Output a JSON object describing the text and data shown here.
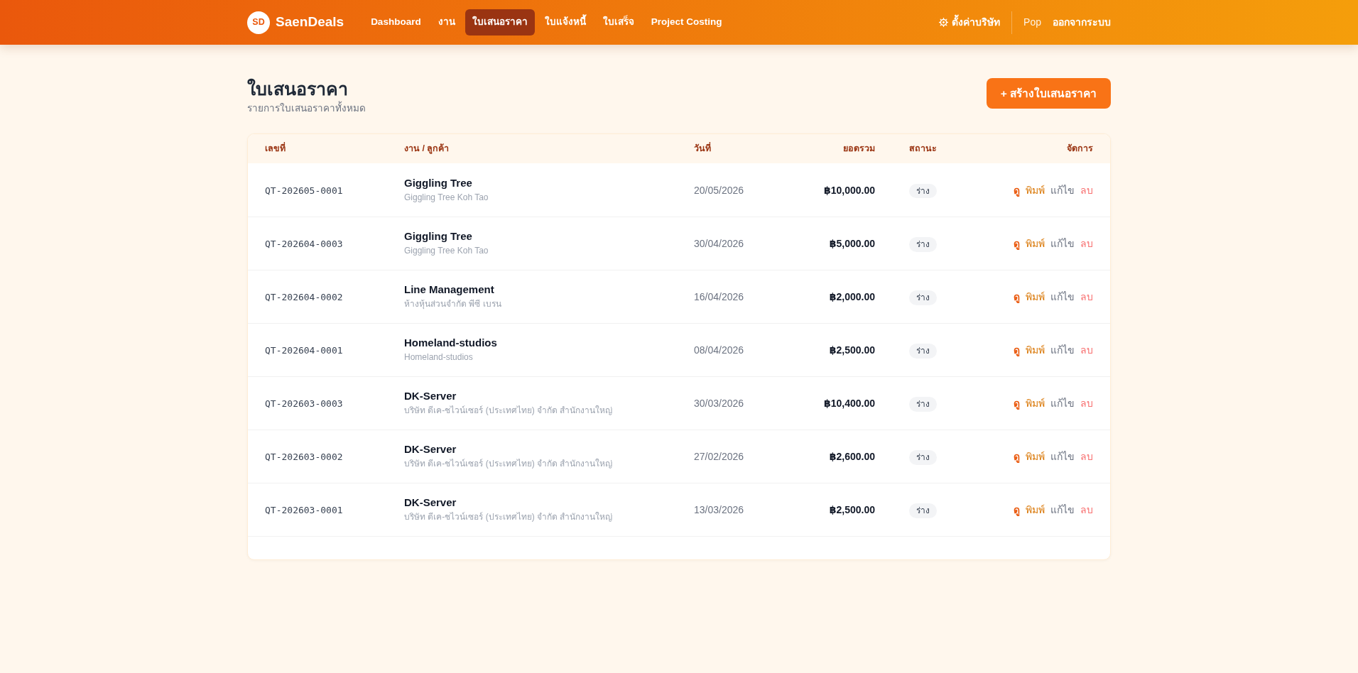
{
  "navbar": {
    "logo": "SD",
    "brand": "SaenDeals",
    "items": [
      {
        "label": "Dashboard",
        "selected": false
      },
      {
        "label": "งาน",
        "selected": false
      },
      {
        "label": "ใบเสนอราคา",
        "selected": true
      },
      {
        "label": "ใบแจ้งหนี้",
        "selected": false
      },
      {
        "label": "ใบเสร็จ",
        "selected": false
      },
      {
        "label": "Project Costing",
        "selected": false
      }
    ],
    "settings": "ตั้งค่าบริษัท",
    "user": "Pop",
    "logout": "ออกจากระบบ"
  },
  "page": {
    "title": "ใบเสนอราคา",
    "subtitle": "รายการใบเสนอราคาทั้งหมด",
    "create_button": "+ สร้างใบเสนอราคา"
  },
  "table": {
    "columns": [
      "เลขที่",
      "งาน / ลูกค้า",
      "วันที่",
      "ยอดรวม",
      "สถานะ",
      "จัดการ"
    ],
    "rows": [
      {
        "number": "QT-202605-0001",
        "job": "Giggling Tree",
        "customer": "Giggling Tree Koh Tao",
        "date": "20/05/2026",
        "total": "฿10,000.00",
        "status": "ร่าง",
        "actions": [
          {
            "label": "ดู",
            "kind": "view"
          },
          {
            "label": "พิมพ์",
            "kind": "print"
          },
          {
            "label": "แก้ไข",
            "kind": "edit"
          },
          {
            "label": "ลบ",
            "kind": "delete"
          }
        ]
      },
      {
        "number": "QT-202604-0003",
        "job": "Giggling Tree",
        "customer": "Giggling Tree Koh Tao",
        "date": "30/04/2026",
        "total": "฿5,000.00",
        "status": "ร่าง",
        "actions": [
          {
            "label": "ดู",
            "kind": "view"
          },
          {
            "label": "พิมพ์",
            "kind": "print"
          },
          {
            "label": "แก้ไข",
            "kind": "edit"
          },
          {
            "label": "ลบ",
            "kind": "delete"
          }
        ]
      },
      {
        "number": "QT-202604-0002",
        "job": "Line Management",
        "customer": "ห้างหุ้นส่วนจำกัด พีซี เบรน",
        "date": "16/04/2026",
        "total": "฿2,000.00",
        "status": "ร่าง",
        "actions": [
          {
            "label": "ดู",
            "kind": "view"
          },
          {
            "label": "พิมพ์",
            "kind": "print"
          },
          {
            "label": "แก้ไข",
            "kind": "edit"
          },
          {
            "label": "ลบ",
            "kind": "delete"
          }
        ]
      },
      {
        "number": "QT-202604-0001",
        "job": "Homeland-studios",
        "customer": "Homeland-studios",
        "date": "08/04/2026",
        "total": "฿2,500.00",
        "status": "ร่าง",
        "actions": [
          {
            "label": "ดู",
            "kind": "view"
          },
          {
            "label": "พิมพ์",
            "kind": "print"
          },
          {
            "label": "แก้ไข",
            "kind": "edit"
          },
          {
            "label": "ลบ",
            "kind": "delete"
          }
        ]
      },
      {
        "number": "QT-202603-0003",
        "job": "DK-Server",
        "customer": "บริษัท ดีเค-ชไวน์เซอร์ (ประเทศไทย) จำกัด สำนักงานใหญ่",
        "date": "30/03/2026",
        "total": "฿10,400.00",
        "status": "ร่าง",
        "actions": [
          {
            "label": "ดู",
            "kind": "view"
          },
          {
            "label": "พิมพ์",
            "kind": "print"
          },
          {
            "label": "แก้ไข",
            "kind": "edit"
          },
          {
            "label": "ลบ",
            "kind": "delete"
          }
        ]
      },
      {
        "number": "QT-202603-0002",
        "job": "DK-Server",
        "customer": "บริษัท ดีเค-ชไวน์เซอร์ (ประเทศไทย) จำกัด สำนักงานใหญ่",
        "date": "27/02/2026",
        "total": "฿2,600.00",
        "status": "ร่าง",
        "actions": [
          {
            "label": "ดู",
            "kind": "view"
          },
          {
            "label": "พิมพ์",
            "kind": "print"
          },
          {
            "label": "แก้ไข",
            "kind": "edit"
          },
          {
            "label": "ลบ",
            "kind": "delete"
          }
        ]
      },
      {
        "number": "QT-202603-0001",
        "job": "DK-Server",
        "customer": "บริษัท ดีเค-ชไวน์เซอร์ (ประเทศไทย) จำกัด สำนักงานใหญ่",
        "date": "13/03/2026",
        "total": "฿2,500.00",
        "status": "ร่าง",
        "actions": [
          {
            "label": "ดู",
            "kind": "view"
          },
          {
            "label": "พิมพ์",
            "kind": "print"
          },
          {
            "label": "แก้ไข",
            "kind": "edit"
          },
          {
            "label": "ลบ",
            "kind": "delete"
          }
        ]
      }
    ]
  }
}
